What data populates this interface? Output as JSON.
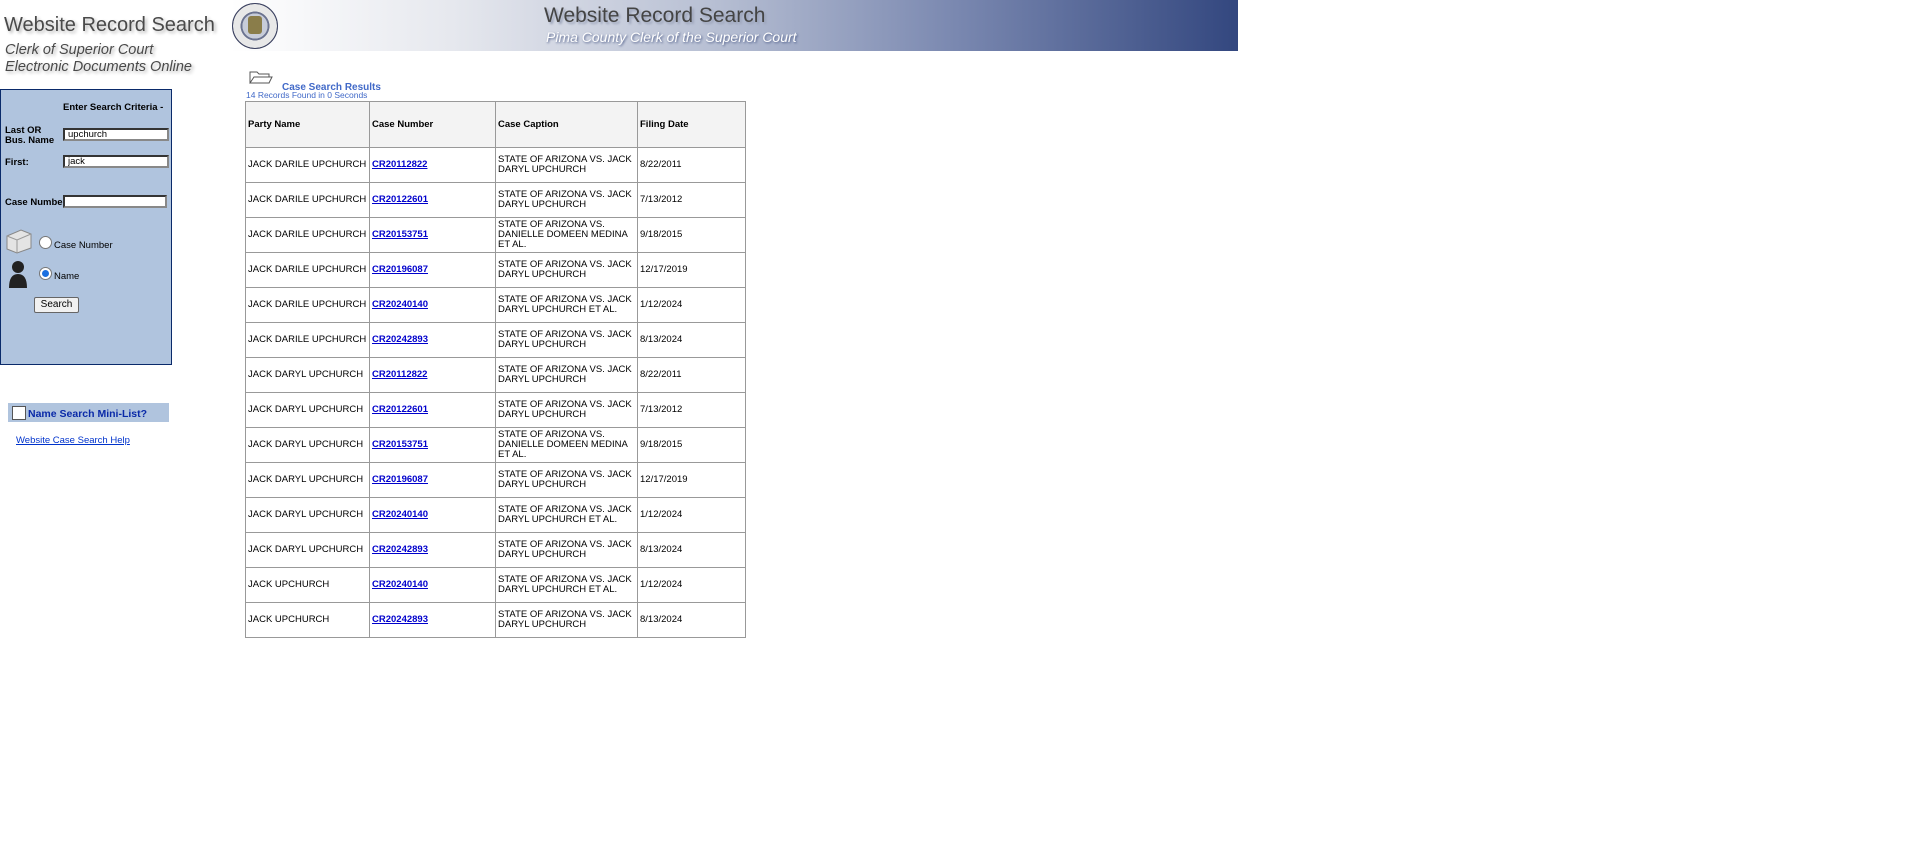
{
  "header": {
    "site_title": "Website Record Search",
    "site_sub1": "Clerk of Superior Court",
    "site_sub2": "Electronic Documents Online",
    "banner_title": "Website Record Search",
    "banner_sub": "Pima County Clerk of the Superior Court"
  },
  "search_panel": {
    "heading": "Enter Search Criteria -",
    "last_name_label": "Last OR Bus. Name",
    "last_name_value": "upchurch",
    "first_label": "First:",
    "first_value": "jack",
    "case_number_label": "Case Number",
    "case_number_value": "",
    "radio_case_label": "Case Number",
    "radio_name_label": "Name",
    "selected_mode": "Name",
    "search_button": "Search"
  },
  "mini_list": {
    "label": "Name Search Mini-List?",
    "checked": false
  },
  "help_link": "Website Case Search Help",
  "results": {
    "title": "Case Search Results",
    "count_text": "14 Records Found in 0 Seconds",
    "columns": [
      "Party Name",
      "Case Number",
      "Case Caption",
      "Filing Date"
    ],
    "rows": [
      {
        "party": "JACK DARILE UPCHURCH",
        "case": "CR20112822",
        "caption": "STATE OF ARIZONA VS. JACK DARYL UPCHURCH",
        "date": "8/22/2011"
      },
      {
        "party": "JACK DARILE UPCHURCH",
        "case": "CR20122601",
        "caption": "STATE OF ARIZONA VS. JACK DARYL UPCHURCH",
        "date": "7/13/2012"
      },
      {
        "party": "JACK DARILE UPCHURCH",
        "case": "CR20153751",
        "caption": "STATE OF ARIZONA VS. DANIELLE DOMEEN MEDINA ET AL.",
        "date": "9/18/2015"
      },
      {
        "party": "JACK DARILE UPCHURCH",
        "case": "CR20196087",
        "caption": "STATE OF ARIZONA VS. JACK DARYL UPCHURCH",
        "date": "12/17/2019"
      },
      {
        "party": "JACK DARILE UPCHURCH",
        "case": "CR20240140",
        "caption": "STATE OF ARIZONA VS. JACK DARYL UPCHURCH ET AL.",
        "date": "1/12/2024"
      },
      {
        "party": "JACK DARILE UPCHURCH",
        "case": "CR20242893",
        "caption": "STATE OF ARIZONA VS. JACK DARYL UPCHURCH",
        "date": "8/13/2024"
      },
      {
        "party": "JACK DARYL UPCHURCH",
        "case": "CR20112822",
        "caption": "STATE OF ARIZONA VS. JACK DARYL UPCHURCH",
        "date": "8/22/2011"
      },
      {
        "party": "JACK DARYL UPCHURCH",
        "case": "CR20122601",
        "caption": "STATE OF ARIZONA VS. JACK DARYL UPCHURCH",
        "date": "7/13/2012"
      },
      {
        "party": "JACK DARYL UPCHURCH",
        "case": "CR20153751",
        "caption": "STATE OF ARIZONA VS. DANIELLE DOMEEN MEDINA ET AL.",
        "date": "9/18/2015"
      },
      {
        "party": "JACK DARYL UPCHURCH",
        "case": "CR20196087",
        "caption": "STATE OF ARIZONA VS. JACK DARYL UPCHURCH",
        "date": "12/17/2019"
      },
      {
        "party": "JACK DARYL UPCHURCH",
        "case": "CR20240140",
        "caption": "STATE OF ARIZONA VS. JACK DARYL UPCHURCH ET AL.",
        "date": "1/12/2024"
      },
      {
        "party": "JACK DARYL UPCHURCH",
        "case": "CR20242893",
        "caption": "STATE OF ARIZONA VS. JACK DARYL UPCHURCH",
        "date": "8/13/2024"
      },
      {
        "party": "JACK UPCHURCH",
        "case": "CR20240140",
        "caption": "STATE OF ARIZONA VS. JACK DARYL UPCHURCH ET AL.",
        "date": "1/12/2024"
      },
      {
        "party": "JACK UPCHURCH",
        "case": "CR20242893",
        "caption": "STATE OF ARIZONA VS. JACK DARYL UPCHURCH",
        "date": "8/13/2024"
      }
    ]
  },
  "icons": {
    "seal": "court-seal-icon",
    "folder": "folder-icon",
    "person": "person-icon",
    "results_folder": "open-folder-icon"
  },
  "colors": {
    "panel_bg": "#b0c4de",
    "link": "#0000cc",
    "results_title": "#4169c8",
    "banner_dark": "#33477f"
  }
}
